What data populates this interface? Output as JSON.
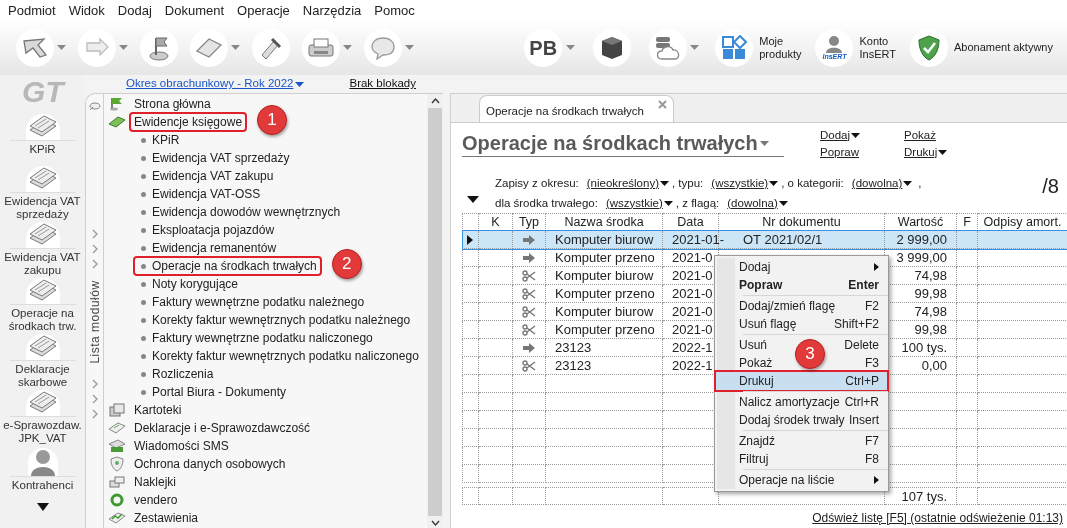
{
  "menu_bar": [
    "Podmiot",
    "Widok",
    "Dodaj",
    "Dokument",
    "Operacje",
    "Narzędzia",
    "Pomoc"
  ],
  "toolbar": {
    "left": [
      {
        "dropdown": true
      },
      {
        "dropdown": true
      },
      {
        "dropdown": false
      },
      {
        "dropdown": true
      },
      {
        "dropdown": false
      },
      {
        "dropdown": true
      },
      {
        "dropdown": true
      }
    ],
    "right": [
      {
        "kind": "text",
        "label": [
          "PB"
        ],
        "dropdown": true
      },
      {
        "kind": "icon",
        "dropdown": false
      },
      {
        "kind": "icon",
        "dropdown": true
      },
      {
        "kind": "labeled",
        "label": [
          "Moje",
          "produkty"
        ],
        "dropdown": false
      },
      {
        "kind": "labeled",
        "label": [
          "Konto",
          "InsERT"
        ],
        "badge": "InsERT",
        "dropdown": false
      },
      {
        "kind": "labeled",
        "label": [
          "Abonament aktywny"
        ],
        "dropdown": false
      }
    ]
  },
  "left_nav": {
    "logo": "GT",
    "items": [
      [
        "KPiR"
      ],
      [
        "Ewidencja VAT",
        "sprzedaży"
      ],
      [
        "Ewidencja VAT",
        "zakupu"
      ],
      [
        "Operacje na",
        "środkach trw."
      ],
      [
        "Deklaracje",
        "skarbowe"
      ],
      [
        "e-Sprawozdaw.",
        "JPK_VAT"
      ],
      [
        "Kontrahenci"
      ]
    ]
  },
  "period_link": "Okres obrachunkowy - Rok 2022",
  "lock_link": "Brak blokady",
  "module_strip": "Lista modułów",
  "tree": [
    {
      "label": "Strona główna"
    },
    {
      "label": "Ewidencje księgowe",
      "highlighted": true,
      "callout": "1",
      "expanded": true,
      "children": [
        {
          "label": "KPiR"
        },
        {
          "label": "Ewidencja VAT sprzedaży"
        },
        {
          "label": "Ewidencja VAT zakupu"
        },
        {
          "label": "Ewidencja VAT-OSS"
        },
        {
          "label": "Ewidencja dowodów wewnętrznych"
        },
        {
          "label": "Eksploatacja pojazdów"
        },
        {
          "label": "Ewidencja remanentów"
        },
        {
          "label": "Operacje na środkach trwałych",
          "highlighted": true,
          "callout": "2"
        },
        {
          "label": "Noty korygujące"
        },
        {
          "label": "Faktury wewnętrzne podatku należnego"
        },
        {
          "label": "Korekty faktur wewnętrznych podatku należnego"
        },
        {
          "label": "Faktury wewnętrzne podatku naliczonego"
        },
        {
          "label": "Korekty faktur wewnętrznych podatku naliczonego"
        },
        {
          "label": "Rozliczenia"
        },
        {
          "label": "Portal Biura - Dokumenty"
        }
      ]
    },
    {
      "label": "Kartoteki"
    },
    {
      "label": "Deklaracje i e-Sprawozdawczość"
    },
    {
      "label": "Wiadomości SMS"
    },
    {
      "label": "Ochrona danych osobowych"
    },
    {
      "label": "Naklejki"
    },
    {
      "label": "vendero"
    },
    {
      "label": "Zestawienia"
    }
  ],
  "tab": {
    "label": "Operacje na środkach trwałych"
  },
  "title": "Operacje na środkach trwałych",
  "actions": [
    {
      "label": "Dodaj",
      "dropdown": true
    },
    {
      "label": "Popraw",
      "dropdown": false
    },
    {
      "label": "Pokaż",
      "dropdown": false
    },
    {
      "label": "Drukuj",
      "dropdown": true
    }
  ],
  "filters": [
    [
      {
        "label": "Zapisy z okresu:",
        "value": "(nieokreślony)"
      },
      {
        "label": ", typu:",
        "value": "(wszystkie)"
      },
      {
        "label": ", o kategorii:",
        "value": "(dowolna)",
        "suffix": ","
      }
    ],
    [
      {
        "label": "dla środka trwałego:",
        "value": "(wszystkie)"
      },
      {
        "label": ", z flagą:",
        "value": "(dowolna)"
      }
    ]
  ],
  "count": "/8",
  "table": {
    "columns": [
      "K",
      "Typ",
      "Nazwa środka",
      "Data",
      "Nr dokumentu",
      "Wartość",
      "F",
      "Odpisy amort."
    ],
    "rows": [
      {
        "kind": "arrow",
        "name": "Komputer biurow",
        "date": "2021-01-",
        "doc": "OT 2021/02/1",
        "value": "2 999,00",
        "selected": true
      },
      {
        "kind": "arrow",
        "name": "Komputer przeno",
        "date": "2021-0",
        "value": "3 999,00",
        "selected": false
      },
      {
        "kind": "scissors",
        "name": "Komputer biurow",
        "date": "2021-0",
        "value": "74,98",
        "selected": false
      },
      {
        "kind": "scissors",
        "name": "Komputer przeno",
        "date": "2021-0",
        "value": "99,98",
        "selected": false
      },
      {
        "kind": "scissors",
        "name": "Komputer biurow",
        "date": "2021-0",
        "value": "74,98",
        "selected": false
      },
      {
        "kind": "scissors",
        "name": "Komputer przeno",
        "date": "2021-0",
        "value": "99,98",
        "selected": false
      },
      {
        "kind": "arrow",
        "name": "23123",
        "date": "2022-1",
        "value": "100 tys.",
        "selected": false
      },
      {
        "kind": "scissors",
        "name": "23123",
        "date": "2022-1",
        "value": "0,00",
        "selected": false
      }
    ],
    "total": "107 tys."
  },
  "refresh_link": "Odśwież listę [F5] (ostatnie odświeżenie 01:13)",
  "context_menu": [
    [
      {
        "label": "Dodaj",
        "submenu": true,
        "selected": false
      },
      {
        "label": "Popraw",
        "shortcut": "Enter",
        "bold": true,
        "selected": false
      }
    ],
    [
      {
        "label": "Dodaj/zmień flagę",
        "shortcut": "F2",
        "selected": false
      },
      {
        "label": "Usuń flagę",
        "shortcut": "Shift+F2",
        "selected": false
      }
    ],
    [
      {
        "label": "Usuń",
        "shortcut": "Delete",
        "selected": false
      },
      {
        "label": "Pokaż",
        "shortcut": "F3",
        "selected": false
      },
      {
        "label": "Drukuj",
        "shortcut": "Ctrl+P",
        "selected": true,
        "highlighted": true,
        "callout": "3"
      }
    ],
    [
      {
        "label": "Nalicz amortyzacje",
        "shortcut": "Ctrl+R",
        "selected": false
      },
      {
        "label": "Dodaj środek trwały",
        "shortcut": "Insert",
        "selected": false
      }
    ],
    [
      {
        "label": "Znajdź",
        "shortcut": "F7",
        "selected": false
      },
      {
        "label": "Filtruj",
        "shortcut": "F8",
        "selected": false
      }
    ],
    [
      {
        "label": "Operacje na liście",
        "submenu": true,
        "selected": false
      }
    ]
  ]
}
